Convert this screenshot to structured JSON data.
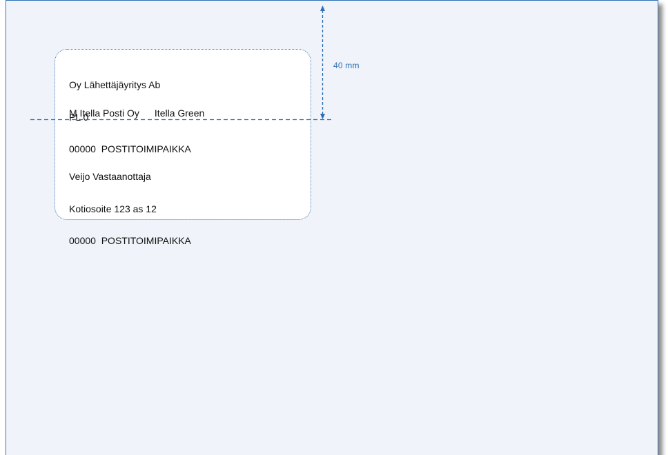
{
  "sender": {
    "line1": "Oy Lähettäjäyritys Ab",
    "line2": "PL 0",
    "line3": "00000  POSTITOIMIPAIKKA"
  },
  "postage": {
    "mark": "M Itella Posti Oy",
    "service": "Itella Green"
  },
  "recipient": {
    "line1": "Veijo Vastaanottaja",
    "line2": "Kotiosoite 123 as 12",
    "line3": "00000  POSTITOIMIPAIKKA"
  },
  "dimension": {
    "label": "40 mm"
  },
  "colors": {
    "sheet_background": "#f0f3f9",
    "guide_blue": "#2e6fb3",
    "window_border": "#3a76b8"
  }
}
